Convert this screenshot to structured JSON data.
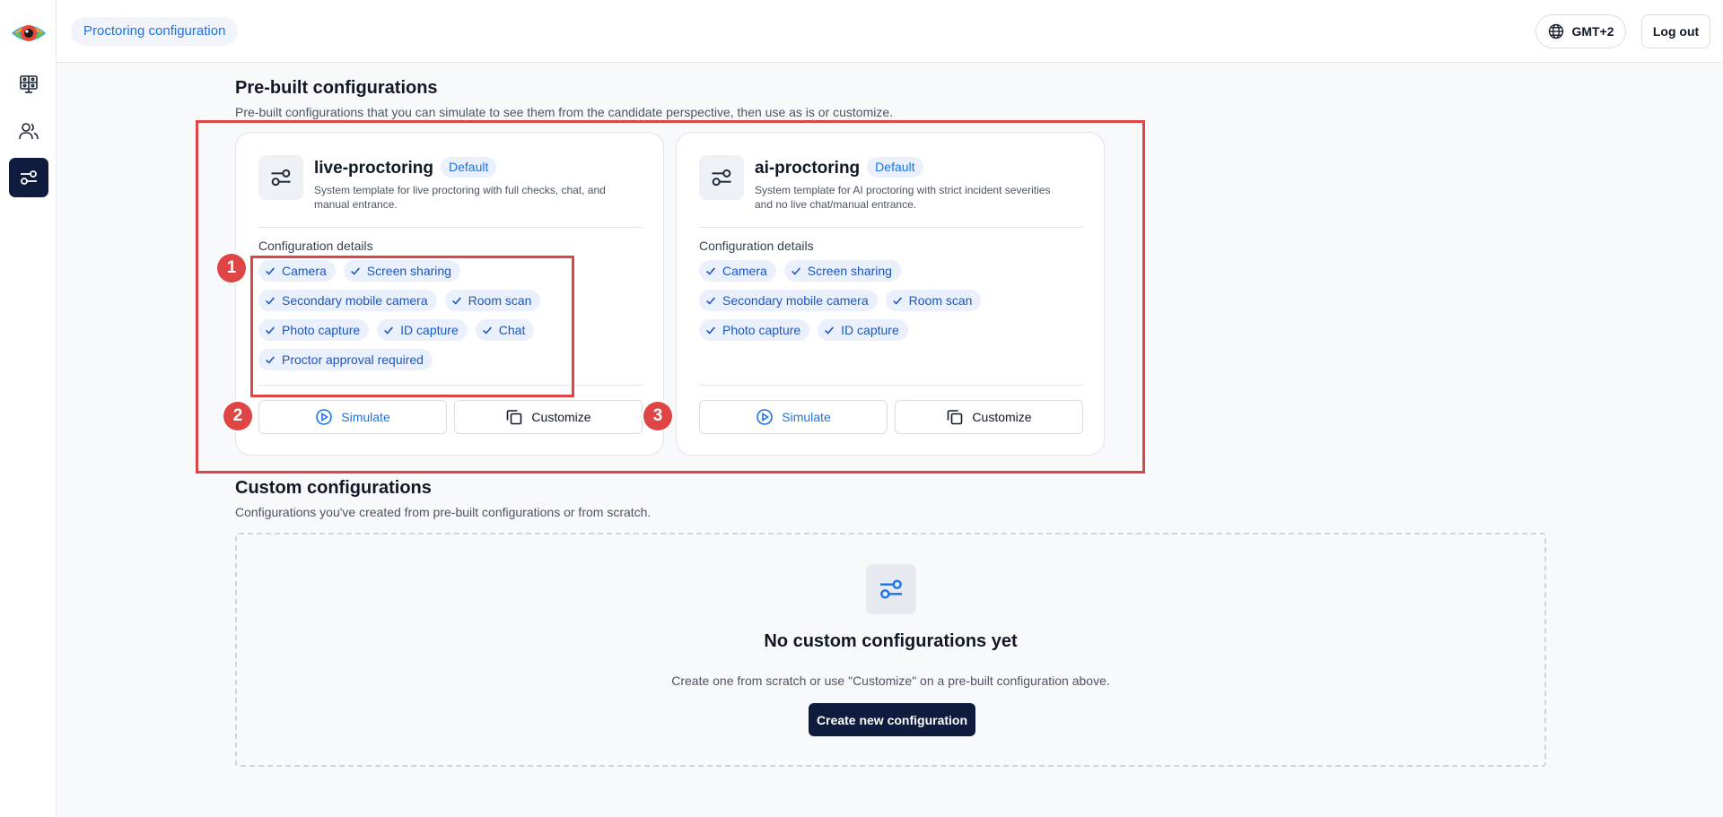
{
  "header": {
    "breadcrumb": "Proctoring configuration",
    "timezone_label": "GMT+2",
    "logout_label": "Log out"
  },
  "sidebar": {
    "items": [
      {
        "icon": "monitor-grid-icon",
        "active": false
      },
      {
        "icon": "users-icon",
        "active": false
      },
      {
        "icon": "sliders-icon",
        "active": true
      }
    ]
  },
  "prebuilt": {
    "title": "Pre-built configurations",
    "subtitle": "Pre-built configurations that you can simulate to see them from the candidate perspective, then use as is or customize.",
    "cards": [
      {
        "name": "live-proctoring",
        "badge": "Default",
        "description": "System template for live proctoring with full checks, chat, and manual entrance.",
        "details_label": "Configuration details",
        "features": [
          "Camera",
          "Screen sharing",
          "Secondary mobile camera",
          "Room scan",
          "Photo capture",
          "ID capture",
          "Chat",
          "Proctor approval required"
        ],
        "simulate_label": "Simulate",
        "customize_label": "Customize"
      },
      {
        "name": "ai-proctoring",
        "badge": "Default",
        "description": "System template for AI proctoring with strict incident severities and no live chat/manual entrance.",
        "details_label": "Configuration details",
        "features": [
          "Camera",
          "Screen sharing",
          "Secondary mobile camera",
          "Room scan",
          "Photo capture",
          "ID capture"
        ],
        "simulate_label": "Simulate",
        "customize_label": "Customize"
      }
    ]
  },
  "custom": {
    "title": "Custom configurations",
    "subtitle": "Configurations you've created from pre-built configurations or from scratch.",
    "empty_title": "No custom configurations yet",
    "empty_subtitle": "Create one from scratch or use \"Customize\" on a pre-built configuration above.",
    "create_label": "Create new configuration"
  },
  "annotations": [
    "1",
    "2",
    "3"
  ],
  "colors": {
    "accent": "#1a73e8",
    "navy": "#0f1b3d",
    "annotation": "#e04545",
    "chip_bg": "#eaf1fd"
  }
}
